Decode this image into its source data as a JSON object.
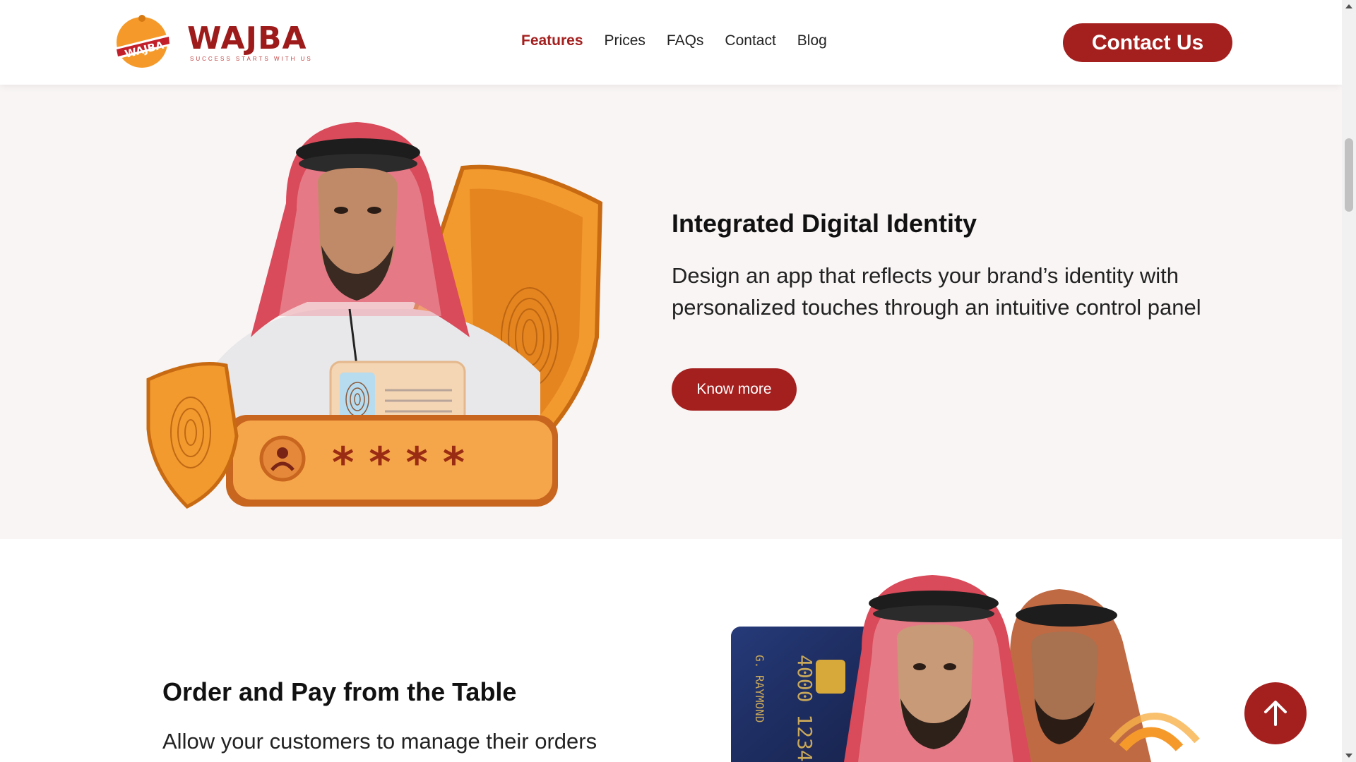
{
  "header": {
    "logo_text": "WAJBA",
    "logo_tagline": "SUCCESS STARTS WITH US",
    "logo_badge_text": "WAJBA",
    "nav": [
      {
        "label": "Features",
        "active": true
      },
      {
        "label": "Prices",
        "active": false
      },
      {
        "label": "FAQs",
        "active": false
      },
      {
        "label": "Contact",
        "active": false
      },
      {
        "label": "Blog",
        "active": false
      }
    ],
    "cta_label": "Contact Us"
  },
  "features": [
    {
      "title": "Integrated Digital Identity",
      "description": "Design an app that reflects your brand’s identity with personalized touches through an intuitive control panel",
      "button_label": "Know more",
      "image_asterisks": "* * * *"
    },
    {
      "title": "Order and Pay from the Table",
      "description": "Allow your customers to manage their orders",
      "card_number": "4000 1234",
      "card_name": "G. RAYMOND"
    }
  ],
  "colors": {
    "brand": "#a4201f",
    "accent_orange": "#f59a2a",
    "section_bg": "#f8f5f4"
  },
  "icons": {
    "scroll_top": "arrow-up-icon"
  }
}
